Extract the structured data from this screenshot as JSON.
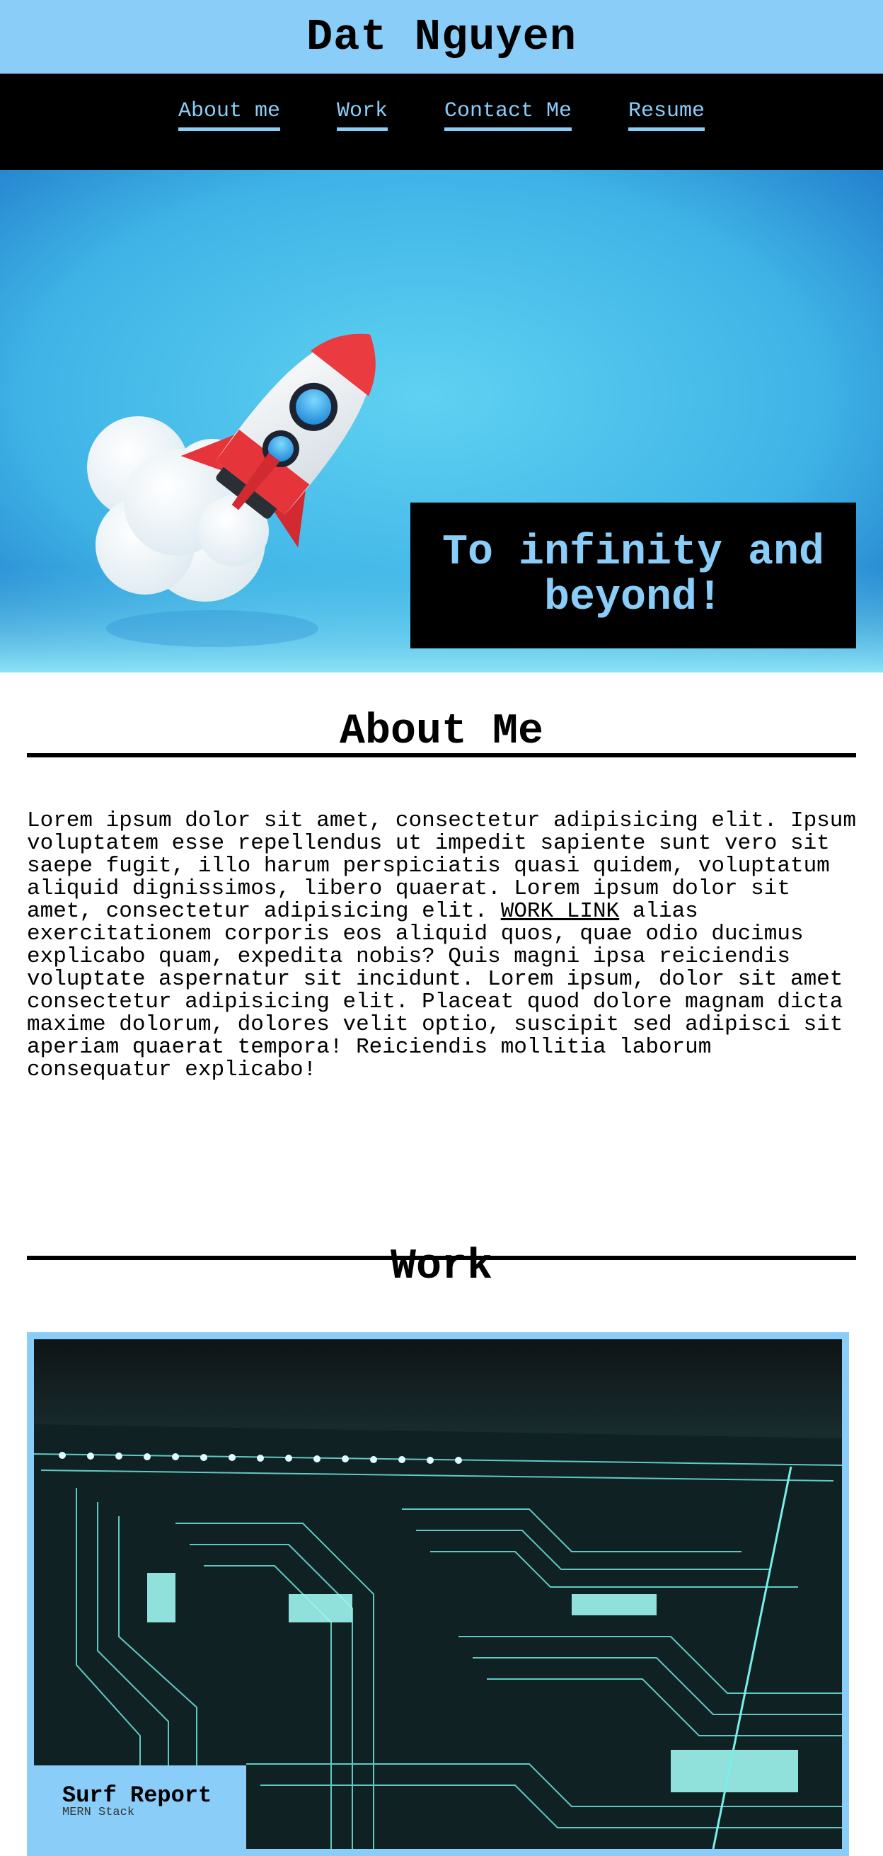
{
  "header": {
    "title": "Dat Nguyen"
  },
  "nav": {
    "items": [
      {
        "label": "About me"
      },
      {
        "label": "Work"
      },
      {
        "label": "Contact Me"
      },
      {
        "label": "Resume"
      }
    ]
  },
  "hero": {
    "tagline": "To infinity and beyond!"
  },
  "about": {
    "title": "About Me",
    "text_before": "Lorem ipsum dolor sit amet, consectetur adipisicing elit. Ipsum voluptatem esse repellendus ut impedit sapiente sunt vero sit saepe fugit, illo harum perspiciatis quasi quidem, voluptatum aliquid dignissimos, libero quaerat. Lorem ipsum dolor sit amet, consectetur adipisicing elit. ",
    "link": "WORK LINK",
    "text_after": " alias exercitationem corporis eos aliquid quos, quae odio ducimus explicabo quam, expedita nobis? Quis magni ipsa reiciendis voluptate aspernatur sit incidunt. Lorem ipsum, dolor sit amet consectetur adipisicing elit. Placeat quod dolore magnam dicta maxime dolorum, dolores velit optio, suscipit sed adipisci sit aperiam quaerat tempora! Reiciendis mollitia laborum consequatur explicabo!"
  },
  "work": {
    "title": "Work",
    "projects": [
      {
        "title": "Surf Report",
        "subtitle": "MERN Stack"
      }
    ]
  },
  "colors": {
    "accent": "#89cdf8",
    "nav_bg": "#000000",
    "page_bg": "#ffffff"
  }
}
